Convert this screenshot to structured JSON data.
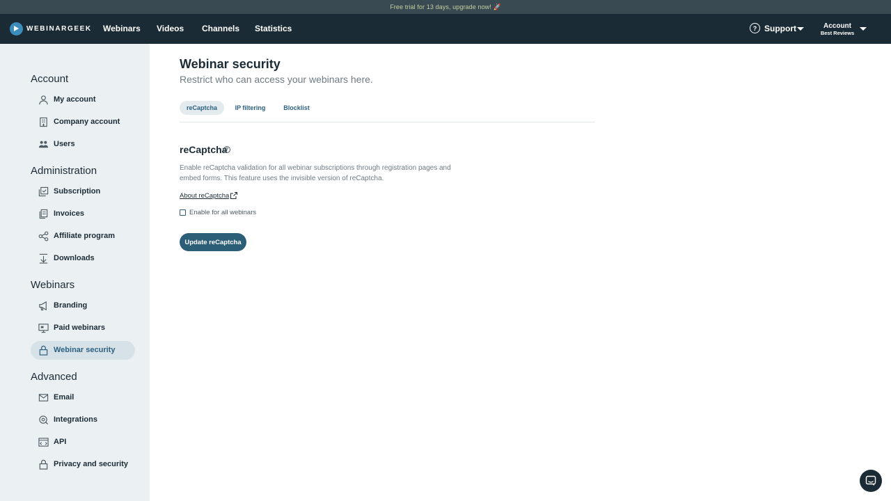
{
  "banner": {
    "text": "Free trial for 13 days, upgrade now! 🚀"
  },
  "brand": {
    "name": "WEBINARGEEK"
  },
  "nav": {
    "items": [
      {
        "label": "Webinars"
      },
      {
        "label": "Videos"
      },
      {
        "label": "Channels"
      },
      {
        "label": "Statistics"
      }
    ],
    "support_label": "Support",
    "account_label": "Account",
    "account_sub": "Best Reviews"
  },
  "sidebar": {
    "sections": [
      {
        "heading": "Account",
        "items": [
          {
            "label": "My account",
            "icon": "user-icon"
          },
          {
            "label": "Company account",
            "icon": "building-icon"
          },
          {
            "label": "Users",
            "icon": "users-icon"
          }
        ]
      },
      {
        "heading": "Administration",
        "items": [
          {
            "label": "Subscription",
            "icon": "subscription-icon"
          },
          {
            "label": "Invoices",
            "icon": "invoices-icon"
          },
          {
            "label": "Affiliate program",
            "icon": "affiliate-icon"
          },
          {
            "label": "Downloads",
            "icon": "download-icon"
          }
        ]
      },
      {
        "heading": "Webinars",
        "items": [
          {
            "label": "Branding",
            "icon": "megaphone-icon"
          },
          {
            "label": "Paid webinars",
            "icon": "monitor-icon"
          },
          {
            "label": "Webinar security",
            "icon": "lock-icon",
            "active": true
          }
        ]
      },
      {
        "heading": "Advanced",
        "items": [
          {
            "label": "Email",
            "icon": "mail-icon"
          },
          {
            "label": "Integrations",
            "icon": "integrations-icon"
          },
          {
            "label": "API",
            "icon": "api-icon"
          },
          {
            "label": "Privacy and security",
            "icon": "lock-icon"
          }
        ]
      }
    ]
  },
  "main": {
    "title": "Webinar security",
    "subtitle": "Restrict who can access your webinars here.",
    "tabs": [
      {
        "label": "reCaptcha",
        "active": true
      },
      {
        "label": "IP filtering"
      },
      {
        "label": "Blocklist"
      }
    ],
    "section": {
      "title": "reCaptcha",
      "description": "Enable reCaptcha validation for all webinar subscriptions through registration pages and embed forms. This feature uses the invisible version of reCaptcha.",
      "about_link": "About reCaptcha",
      "checkbox_label": "Enable for all webinars",
      "checkbox_checked": false,
      "button_label": "Update reCaptcha"
    }
  },
  "colors": {
    "nav_bg": "#1b2b35",
    "sidebar_bg": "#ebf0f3",
    "accent": "#2d5e78"
  }
}
